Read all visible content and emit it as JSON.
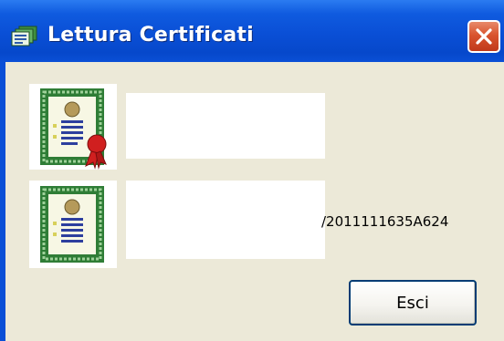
{
  "window": {
    "title": "Lettura Certificati",
    "title_icon": "certificates-icon",
    "close_icon": "close-icon"
  },
  "certificates": [
    {
      "icon": "certificate-with-seal-icon",
      "text": ""
    },
    {
      "icon": "certificate-icon",
      "text": "/2011111635A624"
    }
  ],
  "buttons": {
    "exit_label": "Esci"
  },
  "colors": {
    "titlebar": "#0a4fd6",
    "client": "#ece9d8",
    "close": "#d9542e"
  }
}
